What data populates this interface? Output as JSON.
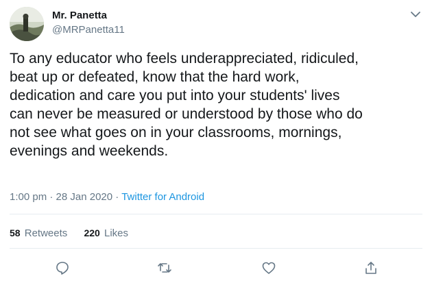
{
  "tweet": {
    "display_name": "Mr. Panetta",
    "handle": "@MRPanetta11",
    "text": "To any educator who feels underappreciated, ridiculed,\nbeat up or defeated, know that the hard work,\ndedication and care you put into your students' lives\ncan never be measured or understood by those who do\nnot see what goes on in your classrooms, mornings,\nevenings and weekends.",
    "time": "1:00 pm",
    "separator": " · ",
    "date": "28 Jan 2020",
    "source": "Twitter for Android"
  },
  "stats": {
    "retweets_count": "58",
    "retweets_label": "Retweets",
    "likes_count": "220",
    "likes_label": "Likes"
  },
  "icons": {
    "menu": "chevron-down-icon",
    "reply": "reply-icon",
    "retweet": "retweet-icon",
    "like": "heart-icon",
    "share": "share-icon"
  },
  "colors": {
    "text": "#14171a",
    "secondary": "#657786",
    "link": "#1b95e0",
    "divider": "#e6ecf0"
  }
}
